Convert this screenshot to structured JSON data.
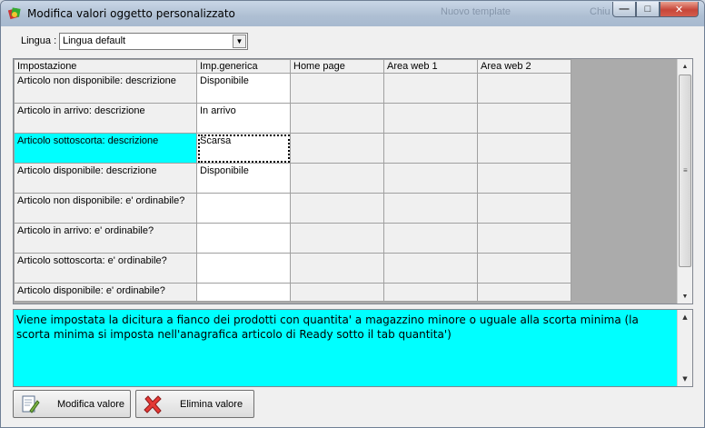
{
  "window": {
    "title": "Modifica valori oggetto personalizzato",
    "bg_hint_1": "Nuovo template",
    "bg_hint_2": "Chiu"
  },
  "language": {
    "label": "Lingua :",
    "selected": "Lingua default"
  },
  "grid": {
    "columns": [
      "Impostazione",
      "Imp.generica",
      "Home page",
      "Area web 1",
      "Area web 2"
    ],
    "rows": [
      {
        "label": "Articolo non disponibile: descrizione",
        "value": "Disponibile"
      },
      {
        "label": "Articolo in arrivo: descrizione",
        "value": "In arrivo"
      },
      {
        "label": "Articolo sottoscorta: descrizione",
        "value": "Scarsa"
      },
      {
        "label": "Articolo disponibile: descrizione",
        "value": "Disponibile"
      },
      {
        "label": "Articolo non disponibile: e' ordinabile?",
        "value": ""
      },
      {
        "label": "Articolo in arrivo: e' ordinabile?",
        "value": ""
      },
      {
        "label": "Articolo sottoscorta: e' ordinabile?",
        "value": ""
      },
      {
        "label": "Articolo disponibile: e' ordinabile?",
        "value": ""
      }
    ]
  },
  "description": "Viene impostata la dicitura a fianco dei prodotti con quantita' a magazzino minore o uguale alla scorta minima (la scorta minima si imposta nell'anagrafica articolo di Ready sotto il tab quantita')",
  "buttons": {
    "edit": "Modifica valore",
    "delete": "Elimina valore"
  },
  "colors": {
    "selection": "#00ffff",
    "description_bg": "#00ffff"
  }
}
